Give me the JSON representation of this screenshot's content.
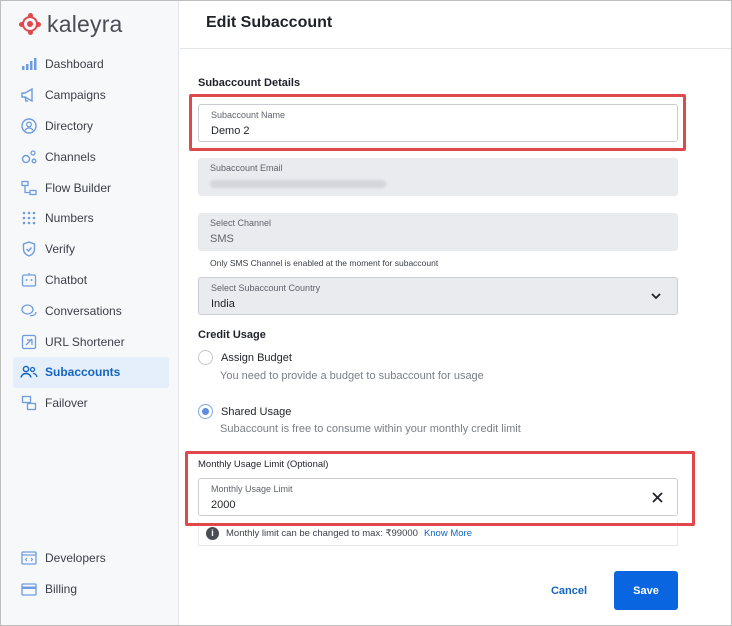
{
  "brand": {
    "name": "kaleyra",
    "color": "#e1484b"
  },
  "sidebar": {
    "items": [
      {
        "label": "Dashboard",
        "icon": "bar-chart-icon"
      },
      {
        "label": "Campaigns",
        "icon": "megaphone-icon"
      },
      {
        "label": "Directory",
        "icon": "contact-icon"
      },
      {
        "label": "Channels",
        "icon": "channels-icon"
      },
      {
        "label": "Flow Builder",
        "icon": "flow-icon"
      },
      {
        "label": "Numbers",
        "icon": "dialpad-icon"
      },
      {
        "label": "Verify",
        "icon": "shield-check-icon"
      },
      {
        "label": "Chatbot",
        "icon": "chatbot-icon"
      },
      {
        "label": "Conversations",
        "icon": "chat-bubbles-icon"
      },
      {
        "label": "URL Shortener",
        "icon": "link-icon"
      },
      {
        "label": "Subaccounts",
        "icon": "users-icon",
        "active": true
      },
      {
        "label": "Failover",
        "icon": "failover-icon"
      }
    ],
    "bottom_items": [
      {
        "label": "Developers",
        "icon": "code-window-icon"
      },
      {
        "label": "Billing",
        "icon": "card-icon"
      }
    ]
  },
  "header": {
    "title": "Edit Subaccount"
  },
  "form": {
    "details_heading": "Subaccount Details",
    "name": {
      "label": "Subaccount Name",
      "value": "Demo 2"
    },
    "email": {
      "label": "Subaccount Email",
      "value_visible": false
    },
    "channel": {
      "label": "Select Channel",
      "value": "SMS",
      "hint": "Only SMS Channel is enabled at the moment for subaccount"
    },
    "country": {
      "label": "Select Subaccount Country",
      "value": "India"
    },
    "credit_heading": "Credit Usage",
    "options": [
      {
        "label": "Assign Budget",
        "description": "You need to provide a budget to subaccount for usage",
        "checked": false
      },
      {
        "label": "Shared Usage",
        "description": "Subaccount is free to consume within your monthly credit limit",
        "checked": true
      }
    ],
    "monthly_limit": {
      "heading": "Monthly Usage Limit (Optional)",
      "label": "Monthly Usage Limit",
      "value": "2000",
      "info": "Monthly limit can be changed to max: ₹99000",
      "info_link": "Know More"
    }
  },
  "actions": {
    "cancel": "Cancel",
    "save": "Save"
  },
  "colors": {
    "accent": "#0a66e0",
    "highlight": "#e0494c",
    "active_bg": "#e5eefb"
  }
}
